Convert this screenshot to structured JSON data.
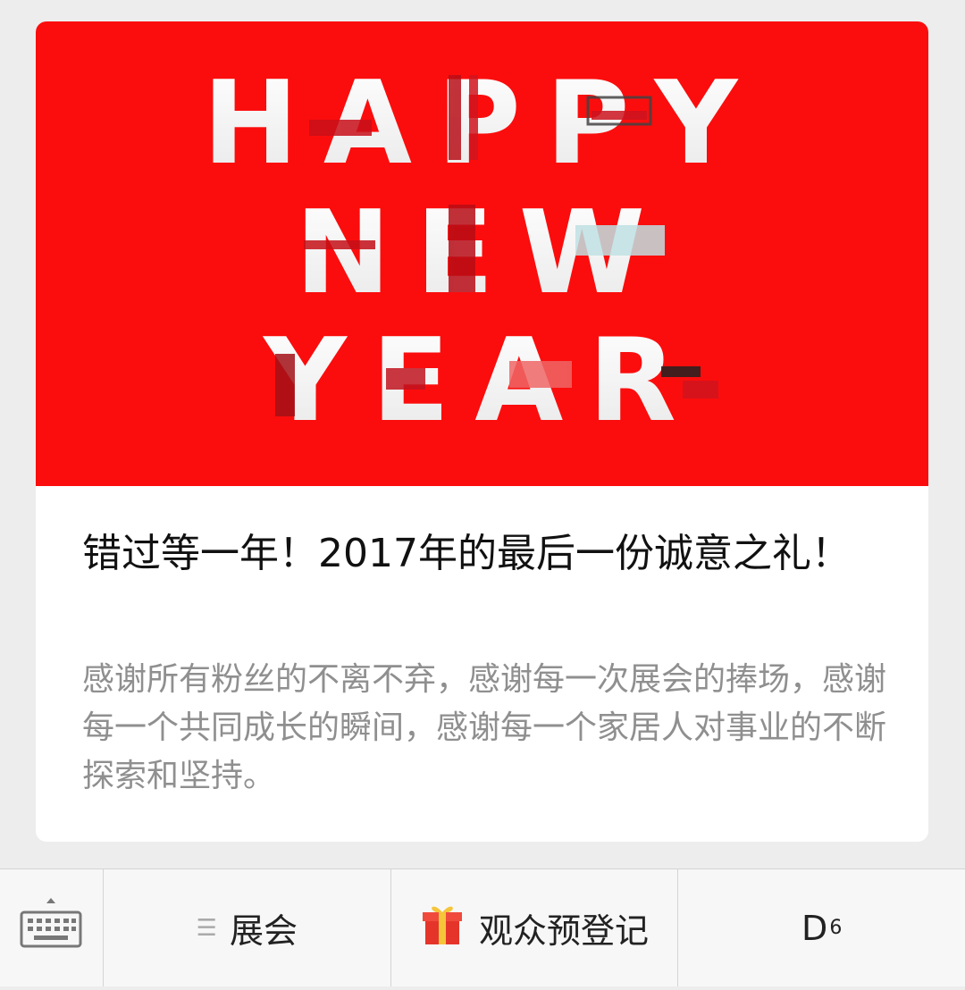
{
  "article": {
    "banner": {
      "line1": "HAPPY",
      "line2": "NEW",
      "line3": "YEAR",
      "background_color": "#fb0d0d"
    },
    "title": "错过等一年！2017年的最后一份诚意之礼！",
    "description": "感谢所有粉丝的不离不弃，感谢每一次展会的捧场，感谢每一个共同成长的瞬间，感谢每一个家居人对事业的不断探索和坚持。"
  },
  "bottom_menu": {
    "keyboard_icon": "keyboard-icon",
    "item1_icon": "menu-lines-icon",
    "item1_label": "展会",
    "item2_icon": "gift-box-icon",
    "item2_label": "观众预登记",
    "item3_label": "D",
    "item3_sup": "6"
  }
}
